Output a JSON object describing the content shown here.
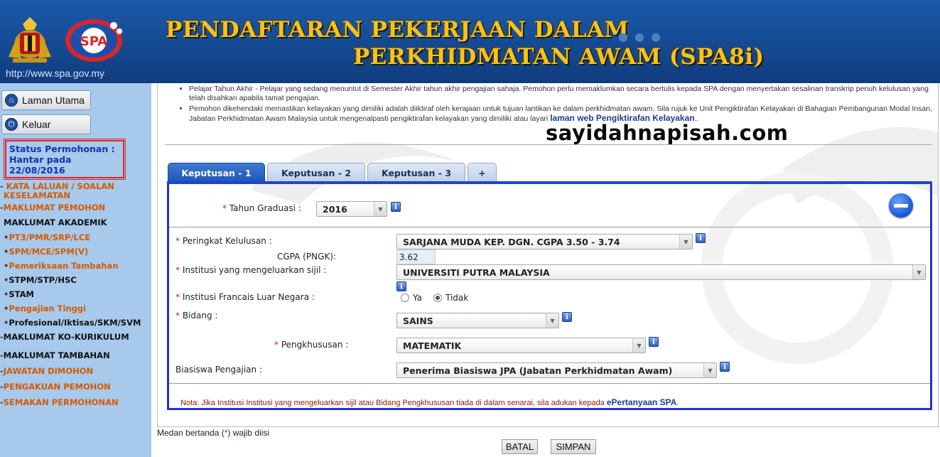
{
  "header": {
    "title_line1": "PENDAFTARAN PEKERJAAN DALAM",
    "title_line2": "PERKHIDMATAN AWAM (SPA8i)",
    "url": "http://www.spa.gov.my",
    "logo2_text": "SPA"
  },
  "sidebar": {
    "btn_home": "Laman Utama",
    "btn_logout": "Keluar",
    "status": {
      "line1": "Status Permohonan :",
      "line2": "Hantar pada",
      "line3": "22/08/2016"
    },
    "items": [
      {
        "prefix": "-",
        "label": "KATA LALUAN / SOALAN",
        "label2": "KESELAMATAN",
        "style": "orange"
      },
      {
        "prefix": "-",
        "label": "MAKLUMAT PEMOHON",
        "style": "orange"
      },
      {
        "prefix": "",
        "label": "MAKLUMAT AKADEMIK",
        "style": "black"
      },
      {
        "prefix": "•",
        "label": "PT3/PMR/SRP/LCE",
        "style": "orange"
      },
      {
        "prefix": "•",
        "label": "SPM/MCE/SPM(V)",
        "style": "orange"
      },
      {
        "prefix": "•",
        "label": "Pemeriksaan Tambahan",
        "style": "orange"
      },
      {
        "prefix": "•",
        "label": "STPM/STP/HSC",
        "style": "black"
      },
      {
        "prefix": "•",
        "label": "STAM",
        "style": "black"
      },
      {
        "prefix": "•",
        "label": "Pengajian Tinggi",
        "style": "orange"
      },
      {
        "prefix": "•",
        "label": "Profesional/Iktisas/SKM/SVM",
        "style": "black"
      },
      {
        "prefix": "-",
        "label": "MAKLUMAT KO-KURIKULUM",
        "style": "black"
      },
      {
        "prefix": "-",
        "label": "MAKLUMAT TAMBAHAN",
        "style": "black"
      },
      {
        "prefix": "-",
        "label": "JAWATAN DIMOHON",
        "style": "orange"
      },
      {
        "prefix": "-",
        "label": "PENGAKUAN PEMOHON",
        "style": "orange"
      },
      {
        "prefix": "-",
        "label": "SEMAKAN PERMOHONAN",
        "style": "orange"
      }
    ]
  },
  "main": {
    "bullet1": "Pelajar Tahun Akhir - Pelajar yang sedang menuntut di Semester Akhir tahun akhir pengajian sahaja. Pemohon perlu memaklumkan secara bertulis kepada SPA dengan menyertakan sesalinan transkrip penuh kelulusan yang telah disahkan apabila tamat pengajian.",
    "bullet2": "Pemohon dikehendaki memastikan kelayakan yang dimiliki adalah diiktiraf oleh kerajaan untuk tujuan lantikan ke dalam perkhidmatan awam. Sila rujuk ke Unit Pengiktirafan Kelayakan di Bahagian Pembangunan Modal Insan, Jabatan Perkhidmatan Awam Malaysia untuk mengenalpasti pengiktirafan kelayakan yang dimiliki atau layari",
    "bullet2_link": "laman web Pengiktirafan Kelayakan",
    "bullet2_end": "..",
    "site_watermark": "sayidahnapisah.com",
    "tabs": [
      "Keputusan - 1",
      "Keputusan - 2",
      "Keputusan - 3",
      "+"
    ],
    "form": {
      "tahun_label": "Tahun Graduasi :",
      "tahun_value": "2016",
      "peringkat_label": "Peringkat Kelulusan :",
      "peringkat_value": "SARJANA MUDA KEP. DGN. CGPA 3.50 - 3.74",
      "cgpa_label": "CGPA (PNGK):",
      "cgpa_value": "3.62",
      "institusi_label": "Institusi yang mengeluarkan sijil :",
      "institusi_value": "UNIVERSITI PUTRA MALAYSIA",
      "francais_label": "Institusi Francais Luar Negara :",
      "radio_ya": "Ya",
      "radio_tidak": "Tidak",
      "bidang_label": "Bidang :",
      "bidang_value": "SAINS",
      "pengkhususan_label": "Pengkhususan :",
      "pengkhususan_value": "MATEMATIK",
      "biasiswa_label": "Biasiswa Pengajian :",
      "biasiswa_value": "Penerima Biasiswa JPA (Jabatan Perkhidmatan Awam)",
      "required_mark": "*",
      "info_glyph": "i"
    },
    "note_text": "Nota: Jika Institusi Institusi yang mengeluarkan sijil atau Bidang Pengkhususan tiada di dalam senarai, sila adukan kepada",
    "note_link": "ePertanyaan SPA",
    "note_end": "."
  },
  "footer": {
    "mandatory_pre": "Medan bertanda (",
    "mandatory_star": "*",
    "mandatory_post": ") wajib diisi",
    "btn_batal": "BATAL",
    "btn_simpan": "SIMPAN"
  }
}
